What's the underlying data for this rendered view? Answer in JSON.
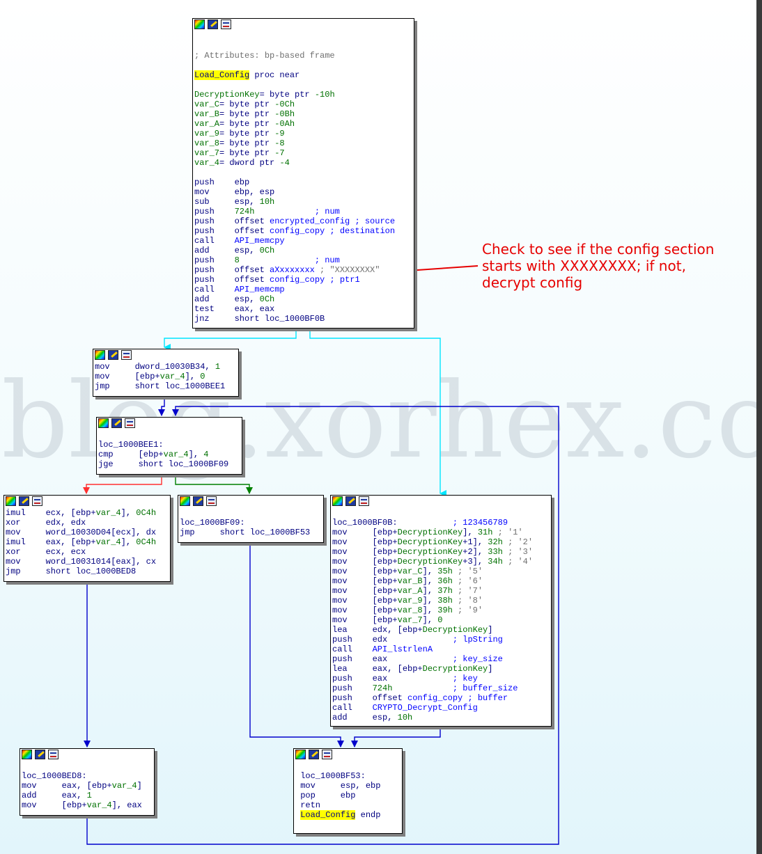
{
  "watermark": "blog.xorhex.com",
  "annotation": {
    "line1": "Check to see if the config section",
    "line2": "starts with XXXXXXXX; if not,",
    "line3": "decrypt config"
  },
  "colors": {
    "arrow_red": "#e60000",
    "edge_cyan": "#00e5ff",
    "edge_blue": "#0000cc",
    "edge_red": "#ff3030",
    "edge_green": "#008000",
    "highlight": "#ffff00"
  },
  "icons": [
    "color-palette-icon",
    "edit-icon",
    "graph-icon"
  ],
  "nodes": {
    "main": {
      "lines": [
        [],
        [],
        [
          {
            "t": "; Attributes: bp-based frame",
            "c": "cmt"
          }
        ],
        [],
        [
          {
            "t": "Load_Config",
            "c": "hl"
          },
          {
            "t": " proc near"
          }
        ],
        [],
        [
          {
            "t": "DecryptionKey",
            "c": "var"
          },
          {
            "t": "= byte ptr "
          },
          {
            "t": "-10h",
            "c": "num"
          }
        ],
        [
          {
            "t": "var_C",
            "c": "var"
          },
          {
            "t": "= byte ptr "
          },
          {
            "t": "-0Ch",
            "c": "num"
          }
        ],
        [
          {
            "t": "var_B",
            "c": "var"
          },
          {
            "t": "= byte ptr "
          },
          {
            "t": "-0Bh",
            "c": "num"
          }
        ],
        [
          {
            "t": "var_A",
            "c": "var"
          },
          {
            "t": "= byte ptr "
          },
          {
            "t": "-0Ah",
            "c": "num"
          }
        ],
        [
          {
            "t": "var_9",
            "c": "var"
          },
          {
            "t": "= byte ptr "
          },
          {
            "t": "-9",
            "c": "num"
          }
        ],
        [
          {
            "t": "var_8",
            "c": "var"
          },
          {
            "t": "= byte ptr "
          },
          {
            "t": "-8",
            "c": "num"
          }
        ],
        [
          {
            "t": "var_7",
            "c": "var"
          },
          {
            "t": "= byte ptr "
          },
          {
            "t": "-7",
            "c": "num"
          }
        ],
        [
          {
            "t": "var_4",
            "c": "var"
          },
          {
            "t": "= dword ptr "
          },
          {
            "t": "-4",
            "c": "num"
          }
        ],
        [],
        [
          {
            "t": "push    ebp"
          }
        ],
        [
          {
            "t": "mov     ebp, esp"
          }
        ],
        [
          {
            "t": "sub     esp, "
          },
          {
            "t": "10h",
            "c": "num"
          }
        ],
        [
          {
            "t": "push    "
          },
          {
            "t": "724h",
            "c": "num"
          },
          {
            "t": "            ; num",
            "c": "nm"
          }
        ],
        [
          {
            "t": "push    offset "
          },
          {
            "t": "encrypted_config",
            "c": "nm"
          },
          {
            "t": " ; source",
            "c": "nm"
          }
        ],
        [
          {
            "t": "push    offset "
          },
          {
            "t": "config_copy",
            "c": "nm"
          },
          {
            "t": " ; destination",
            "c": "nm"
          }
        ],
        [
          {
            "t": "call    "
          },
          {
            "t": "API_memcpy",
            "c": "nm"
          }
        ],
        [
          {
            "t": "add     esp, "
          },
          {
            "t": "0Ch",
            "c": "num"
          }
        ],
        [
          {
            "t": "push    "
          },
          {
            "t": "8",
            "c": "num"
          },
          {
            "t": "               ; num",
            "c": "nm"
          }
        ],
        [
          {
            "t": "push    offset "
          },
          {
            "t": "aXxxxxxxx",
            "c": "nm"
          },
          {
            "t": " ; \"XXXXXXXX\"",
            "c": "str"
          }
        ],
        [
          {
            "t": "push    offset "
          },
          {
            "t": "config_copy",
            "c": "nm"
          },
          {
            "t": " ; ptr1",
            "c": "nm"
          }
        ],
        [
          {
            "t": "call    "
          },
          {
            "t": "API_memcmp",
            "c": "nm"
          }
        ],
        [
          {
            "t": "add     esp, "
          },
          {
            "t": "0Ch",
            "c": "num"
          }
        ],
        [
          {
            "t": "test    eax, eax"
          }
        ],
        [
          {
            "t": "jnz     short loc_1000BF0B"
          }
        ]
      ]
    },
    "n2": {
      "lines": [
        [
          {
            "t": "mov     dword_10030B34, "
          },
          {
            "t": "1",
            "c": "num"
          }
        ],
        [
          {
            "t": "mov     [ebp+"
          },
          {
            "t": "var_4",
            "c": "var"
          },
          {
            "t": "], "
          },
          {
            "t": "0",
            "c": "num"
          }
        ],
        [
          {
            "t": "jmp     short loc_1000BEE1"
          }
        ]
      ]
    },
    "n3": {
      "lines": [
        [],
        [
          {
            "t": "loc_1000BEE1:"
          }
        ],
        [
          {
            "t": "cmp     [ebp+"
          },
          {
            "t": "var_4",
            "c": "var"
          },
          {
            "t": "], "
          },
          {
            "t": "4",
            "c": "num"
          }
        ],
        [
          {
            "t": "jge     short loc_1000BF09"
          }
        ]
      ]
    },
    "n4": {
      "lines": [
        [
          {
            "t": "imul    ecx, [ebp+"
          },
          {
            "t": "var_4",
            "c": "var"
          },
          {
            "t": "], "
          },
          {
            "t": "0C4h",
            "c": "num"
          }
        ],
        [
          {
            "t": "xor     edx, edx"
          }
        ],
        [
          {
            "t": "mov     word_10030D04[ecx], dx"
          }
        ],
        [
          {
            "t": "imul    eax, [ebp+"
          },
          {
            "t": "var_4",
            "c": "var"
          },
          {
            "t": "], "
          },
          {
            "t": "0C4h",
            "c": "num"
          }
        ],
        [
          {
            "t": "xor     ecx, ecx"
          }
        ],
        [
          {
            "t": "mov     word_10031014[eax], cx"
          }
        ],
        [
          {
            "t": "jmp     short loc_1000BED8"
          }
        ]
      ]
    },
    "n5": {
      "lines": [
        [],
        [
          {
            "t": "loc_1000BF09:"
          }
        ],
        [
          {
            "t": "jmp     short loc_1000BF53"
          }
        ]
      ]
    },
    "n6": {
      "lines": [
        [],
        [
          {
            "t": "loc_1000BF0B:"
          },
          {
            "t": "           ; 123456789",
            "c": "nm"
          }
        ],
        [
          {
            "t": "mov     [ebp+"
          },
          {
            "t": "DecryptionKey",
            "c": "var"
          },
          {
            "t": "], "
          },
          {
            "t": "31h",
            "c": "num"
          },
          {
            "t": " ; '1'",
            "c": "cmt"
          }
        ],
        [
          {
            "t": "mov     [ebp+"
          },
          {
            "t": "DecryptionKey",
            "c": "var"
          },
          {
            "t": "+1], "
          },
          {
            "t": "32h",
            "c": "num"
          },
          {
            "t": " ; '2'",
            "c": "cmt"
          }
        ],
        [
          {
            "t": "mov     [ebp+"
          },
          {
            "t": "DecryptionKey",
            "c": "var"
          },
          {
            "t": "+2], "
          },
          {
            "t": "33h",
            "c": "num"
          },
          {
            "t": " ; '3'",
            "c": "cmt"
          }
        ],
        [
          {
            "t": "mov     [ebp+"
          },
          {
            "t": "DecryptionKey",
            "c": "var"
          },
          {
            "t": "+3], "
          },
          {
            "t": "34h",
            "c": "num"
          },
          {
            "t": " ; '4'",
            "c": "cmt"
          }
        ],
        [
          {
            "t": "mov     [ebp+"
          },
          {
            "t": "var_C",
            "c": "var"
          },
          {
            "t": "], "
          },
          {
            "t": "35h",
            "c": "num"
          },
          {
            "t": " ; '5'",
            "c": "cmt"
          }
        ],
        [
          {
            "t": "mov     [ebp+"
          },
          {
            "t": "var_B",
            "c": "var"
          },
          {
            "t": "], "
          },
          {
            "t": "36h",
            "c": "num"
          },
          {
            "t": " ; '6'",
            "c": "cmt"
          }
        ],
        [
          {
            "t": "mov     [ebp+"
          },
          {
            "t": "var_A",
            "c": "var"
          },
          {
            "t": "], "
          },
          {
            "t": "37h",
            "c": "num"
          },
          {
            "t": " ; '7'",
            "c": "cmt"
          }
        ],
        [
          {
            "t": "mov     [ebp+"
          },
          {
            "t": "var_9",
            "c": "var"
          },
          {
            "t": "], "
          },
          {
            "t": "38h",
            "c": "num"
          },
          {
            "t": " ; '8'",
            "c": "cmt"
          }
        ],
        [
          {
            "t": "mov     [ebp+"
          },
          {
            "t": "var_8",
            "c": "var"
          },
          {
            "t": "], "
          },
          {
            "t": "39h",
            "c": "num"
          },
          {
            "t": " ; '9'",
            "c": "cmt"
          }
        ],
        [
          {
            "t": "mov     [ebp+"
          },
          {
            "t": "var_7",
            "c": "var"
          },
          {
            "t": "], "
          },
          {
            "t": "0",
            "c": "num"
          }
        ],
        [
          {
            "t": "lea     edx, [ebp+"
          },
          {
            "t": "DecryptionKey",
            "c": "var"
          },
          {
            "t": "]"
          }
        ],
        [
          {
            "t": "push    edx"
          },
          {
            "t": "             ; lpString",
            "c": "nm"
          }
        ],
        [
          {
            "t": "call    "
          },
          {
            "t": "API_lstrlenA",
            "c": "nm"
          }
        ],
        [
          {
            "t": "push    eax"
          },
          {
            "t": "             ; key_size",
            "c": "nm"
          }
        ],
        [
          {
            "t": "lea     eax, [ebp+"
          },
          {
            "t": "DecryptionKey",
            "c": "var"
          },
          {
            "t": "]"
          }
        ],
        [
          {
            "t": "push    eax"
          },
          {
            "t": "             ; key",
            "c": "nm"
          }
        ],
        [
          {
            "t": "push    "
          },
          {
            "t": "724h",
            "c": "num"
          },
          {
            "t": "            ; buffer_size",
            "c": "nm"
          }
        ],
        [
          {
            "t": "push    offset "
          },
          {
            "t": "config_copy",
            "c": "nm"
          },
          {
            "t": " ; buffer",
            "c": "nm"
          }
        ],
        [
          {
            "t": "call    "
          },
          {
            "t": "CRYPTO_Decrypt_Config",
            "c": "nm"
          }
        ],
        [
          {
            "t": "add     esp, "
          },
          {
            "t": "10h",
            "c": "num"
          }
        ]
      ]
    },
    "n7": {
      "lines": [
        [],
        [
          {
            "t": "loc_1000BED8:"
          }
        ],
        [
          {
            "t": "mov     eax, [ebp+"
          },
          {
            "t": "var_4",
            "c": "var"
          },
          {
            "t": "]"
          }
        ],
        [
          {
            "t": "add     eax, "
          },
          {
            "t": "1",
            "c": "num"
          }
        ],
        [
          {
            "t": "mov     [ebp+"
          },
          {
            "t": "var_4",
            "c": "var"
          },
          {
            "t": "], eax"
          }
        ]
      ]
    },
    "n8": {
      "lines": [
        [],
        [
          {
            "t": " loc_1000BF53:"
          }
        ],
        [
          {
            "t": " mov     esp, ebp"
          }
        ],
        [
          {
            "t": " pop     ebp"
          }
        ],
        [
          {
            "t": " retn"
          }
        ],
        [
          {
            "t": " "
          },
          {
            "t": "Load_Config",
            "c": "hl"
          },
          {
            "t": " endp"
          }
        ]
      ]
    }
  }
}
